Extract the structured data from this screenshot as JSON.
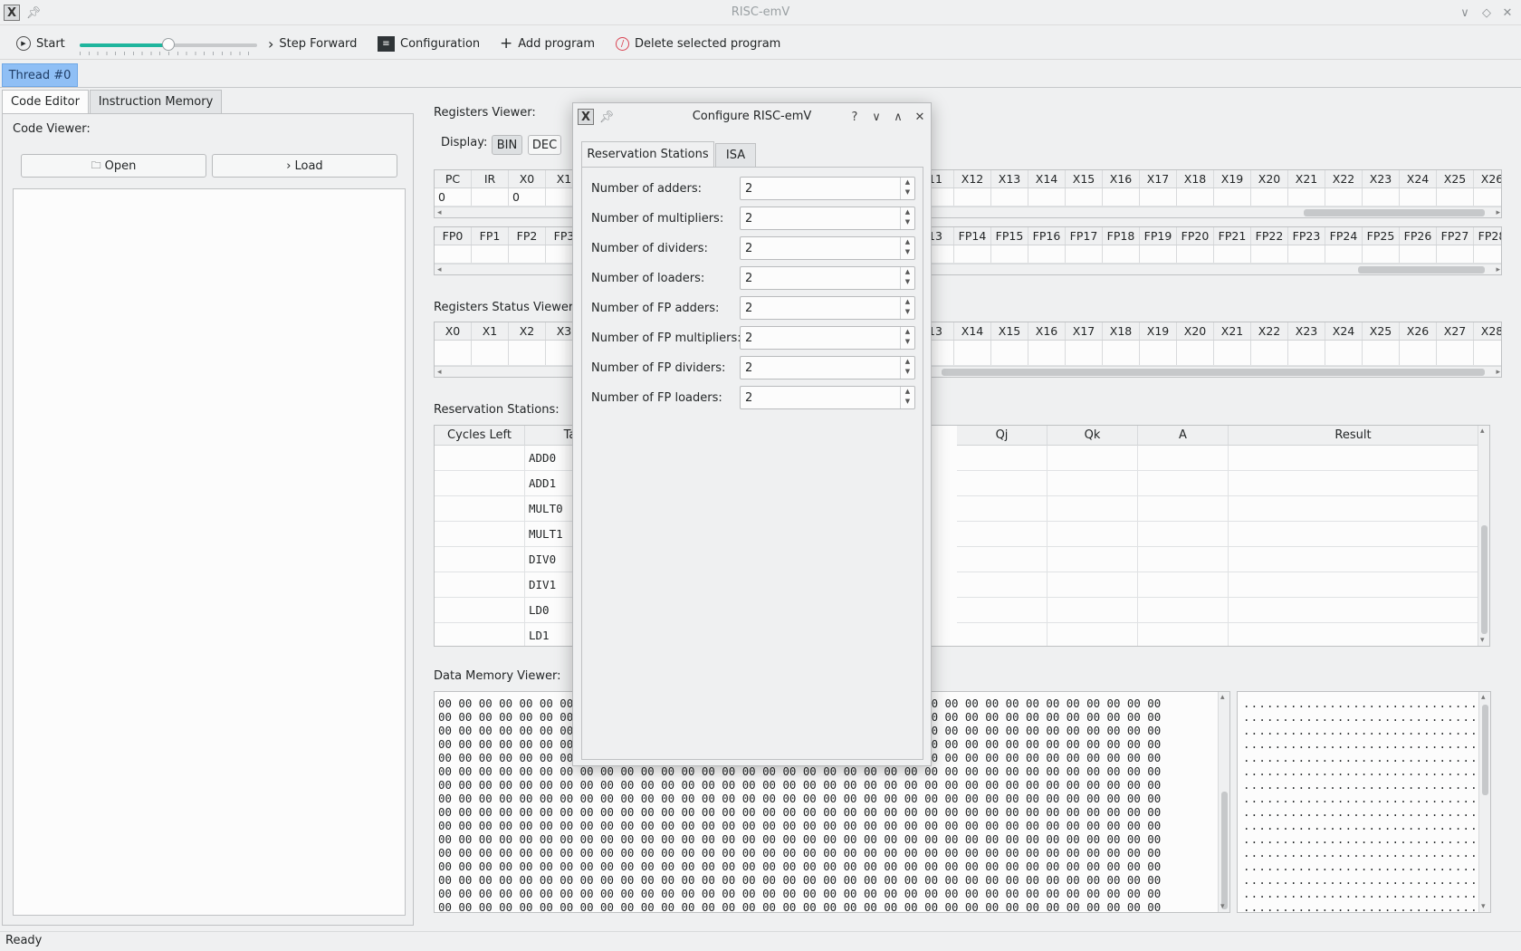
{
  "window": {
    "title": "RISC-emV"
  },
  "toolbar": {
    "start": "Start",
    "speed_value": 0.5,
    "step_forward": "Step Forward",
    "configuration": "Configuration",
    "add_program": "Add program",
    "delete_program": "Delete selected program"
  },
  "threads": {
    "active": "Thread #0"
  },
  "editor": {
    "tabs": [
      "Code Editor",
      "Instruction Memory"
    ],
    "code_viewer_label": "Code Viewer:",
    "open": "Open",
    "load": "Load"
  },
  "registers": {
    "label": "Registers Viewer:",
    "display_label": "Display:",
    "bin": "BIN",
    "dec": "DEC",
    "int_headers_left": [
      "PC",
      "IR",
      "X0",
      "X1"
    ],
    "int_values_left": [
      "0",
      "",
      "0",
      ""
    ],
    "int_headers_right": [
      "11",
      "X12",
      "X13",
      "X14",
      "X15",
      "X16",
      "X17",
      "X18",
      "X19",
      "X20",
      "X21",
      "X22",
      "X23",
      "X24",
      "X25",
      "X26"
    ],
    "fp_headers_left": [
      "FP0",
      "FP1",
      "FP2",
      "FP3"
    ],
    "fp_headers_right": [
      "13",
      "FP14",
      "FP15",
      "FP16",
      "FP17",
      "FP18",
      "FP19",
      "FP20",
      "FP21",
      "FP22",
      "FP23",
      "FP24",
      "FP25",
      "FP26",
      "FP27",
      "FP28"
    ]
  },
  "status": {
    "label": "Registers Status Viewer:",
    "headers_left": [
      "X0",
      "X1",
      "X2",
      "X3"
    ],
    "headers_right": [
      "13",
      "X14",
      "X15",
      "X16",
      "X17",
      "X18",
      "X19",
      "X20",
      "X21",
      "X22",
      "X23",
      "X24",
      "X25",
      "X26",
      "X27",
      "X28"
    ]
  },
  "reservation": {
    "label": "Reservation Stations:",
    "col_cycles": "Cycles Left",
    "col_tag": "Ta",
    "col_qj": "Qj",
    "col_qk": "Qk",
    "col_a": "A",
    "col_result": "Result",
    "rows": [
      "ADD0",
      "ADD1",
      "MULT0",
      "MULT1",
      "DIV0",
      "DIV1",
      "LD0",
      "LD1"
    ]
  },
  "memory": {
    "label": "Data Memory Viewer:",
    "byte": "00",
    "ascii_char": "."
  },
  "statusbar": {
    "text": "Ready"
  },
  "dialog": {
    "title": "Configure RISC-emV",
    "tabs": [
      "Reservation Stations",
      "ISA"
    ],
    "fields": [
      {
        "label": "Number of adders:",
        "value": "2"
      },
      {
        "label": "Number of multipliers:",
        "value": "2"
      },
      {
        "label": "Number of dividers:",
        "value": "2"
      },
      {
        "label": "Number of loaders:",
        "value": "2"
      },
      {
        "label": "Number of FP adders:",
        "value": "2"
      },
      {
        "label": "Number of FP multipliers:",
        "value": "2"
      },
      {
        "label": "Number of FP dividers:",
        "value": "2"
      },
      {
        "label": "Number of FP loaders:",
        "value": "2"
      }
    ]
  }
}
